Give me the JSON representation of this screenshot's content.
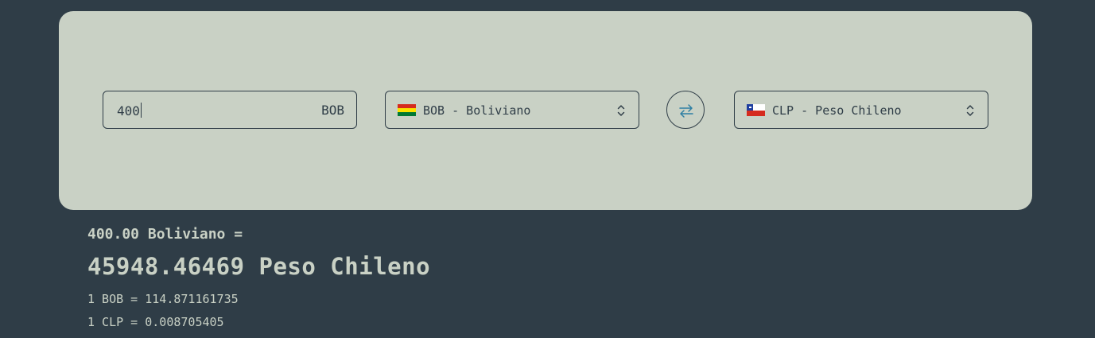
{
  "converter": {
    "amount": {
      "value": "400",
      "currency_code": "BOB"
    },
    "from_select": {
      "flag": "bolivia-flag",
      "label": "BOB - Boliviano"
    },
    "swap_icon": "swap-arrows-icon",
    "to_select": {
      "flag": "chile-flag",
      "label": "CLP - Peso Chileno"
    }
  },
  "result": {
    "from_text": "400.00 Boliviano =",
    "to_text": "45948.46469 Peso Chileno",
    "rates": [
      "1 BOB = 114.871161735",
      "1 CLP = 0.008705405"
    ]
  },
  "colors": {
    "background": "#2f3d47",
    "card": "#c9d1c5",
    "accent": "#2e7fa3"
  }
}
